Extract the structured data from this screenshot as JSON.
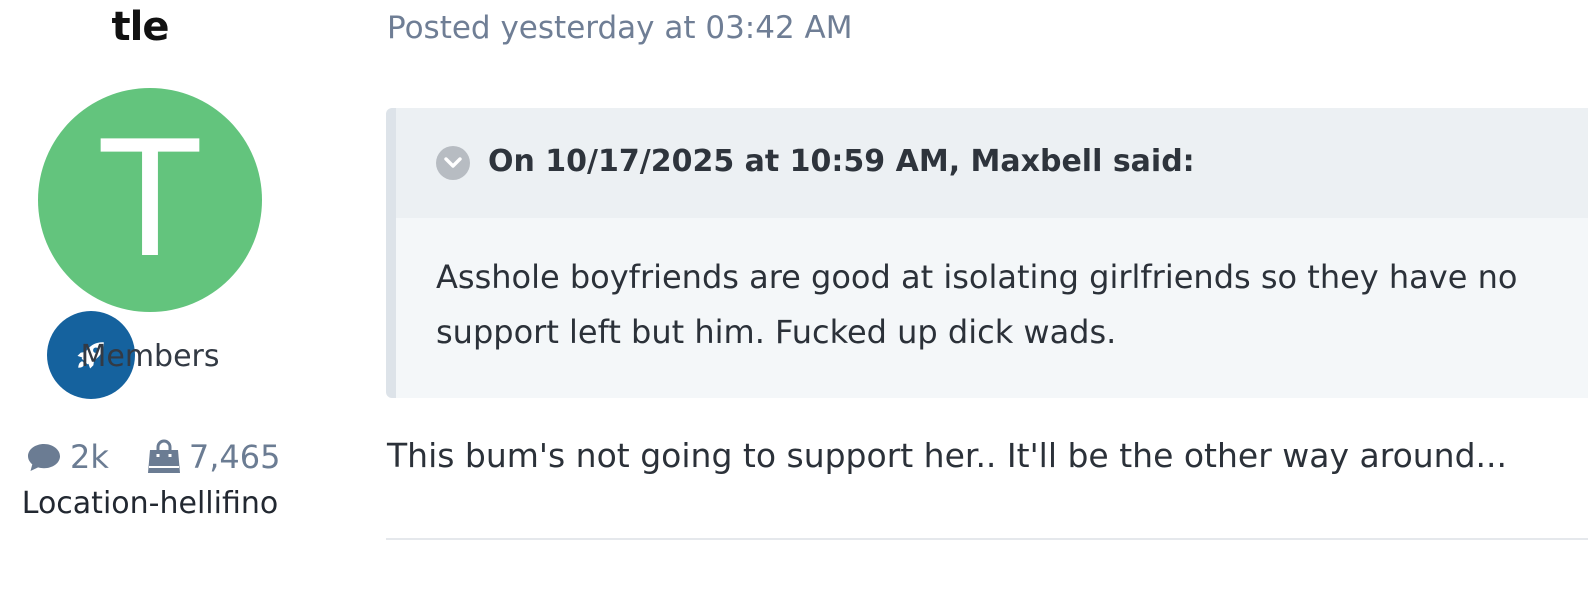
{
  "author": {
    "name": "tle",
    "avatar_letter": "T",
    "avatar_color": "#63c47d",
    "rank_icon": "rocket-icon",
    "rank_badge_color": "#15629e",
    "group": "Members",
    "stats": {
      "posts_icon": "comment-icon",
      "posts": "2k",
      "reputation_icon": "shopping-bag-icon",
      "reputation": "7,465"
    },
    "location": "Location-hellifino"
  },
  "post": {
    "date": "Posted yesterday at 03:42 AM",
    "quote": {
      "toggle_icon": "chevron-down-icon",
      "citation": "On 10/17/2025 at 10:59 AM, Maxbell said:",
      "text": "Asshole boyfriends are good at isolating girlfriends so they have no support left but him. Fucked up dick wads."
    },
    "body": "This bum's not going to support her.. It'll be the other way around..."
  }
}
